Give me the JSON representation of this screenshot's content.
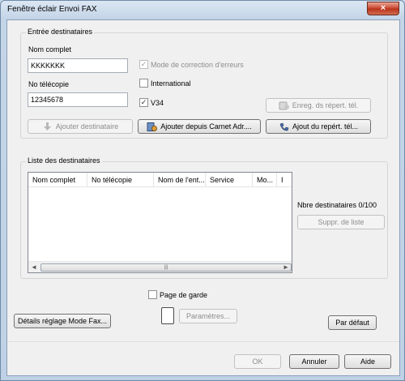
{
  "window": {
    "title": "Fenêtre éclair Envoi FAX",
    "close_glyph": "×"
  },
  "destinations_entry": {
    "group_title": "Entrée destinataires",
    "name_label": "Nom complet",
    "name_value": "KKKKKKK",
    "fax_label": "No télécopie",
    "fax_value": "12345678",
    "ecm_label": "Mode de correction d'erreurs",
    "ecm_checked": true,
    "international_label": "International",
    "international_checked": false,
    "v34_label": "V34",
    "v34_checked": true,
    "register_button": "Enreg. ds répert. tél.",
    "add_destination_button": "Ajouter destinataire",
    "add_from_addressbook_button": "Ajouter depuis Carnet Adr....",
    "add_from_phonebook_button": "Ajout du repért. tél..."
  },
  "destination_list": {
    "group_title": "Liste des destinataires",
    "columns": [
      "Nom complet",
      "No télécopie",
      "Nom de l'ent...",
      "Service",
      "Mo...",
      "I"
    ],
    "count_label": "Nbre destinataires 0/100",
    "delete_button": "Suppr. de liste",
    "scroll_left": "◄",
    "scroll_right": "►",
    "scroll_grip": "|||"
  },
  "cover": {
    "cover_page_label": "Page de garde",
    "cover_page_checked": false,
    "settings_button": "Paramètres..."
  },
  "fax_details_button": "Détails réglage Mode Fax...",
  "default_button": "Par défaut",
  "footer": {
    "ok": "OK",
    "cancel": "Annuler",
    "help": "Aide"
  },
  "icons": {
    "close": "close-icon",
    "phonebook_register": "phonebook-save-icon",
    "add_destination": "down-arrow-icon",
    "address_book": "address-book-icon",
    "phonebook": "phonebook-icon",
    "cover_page": "page-icon"
  }
}
